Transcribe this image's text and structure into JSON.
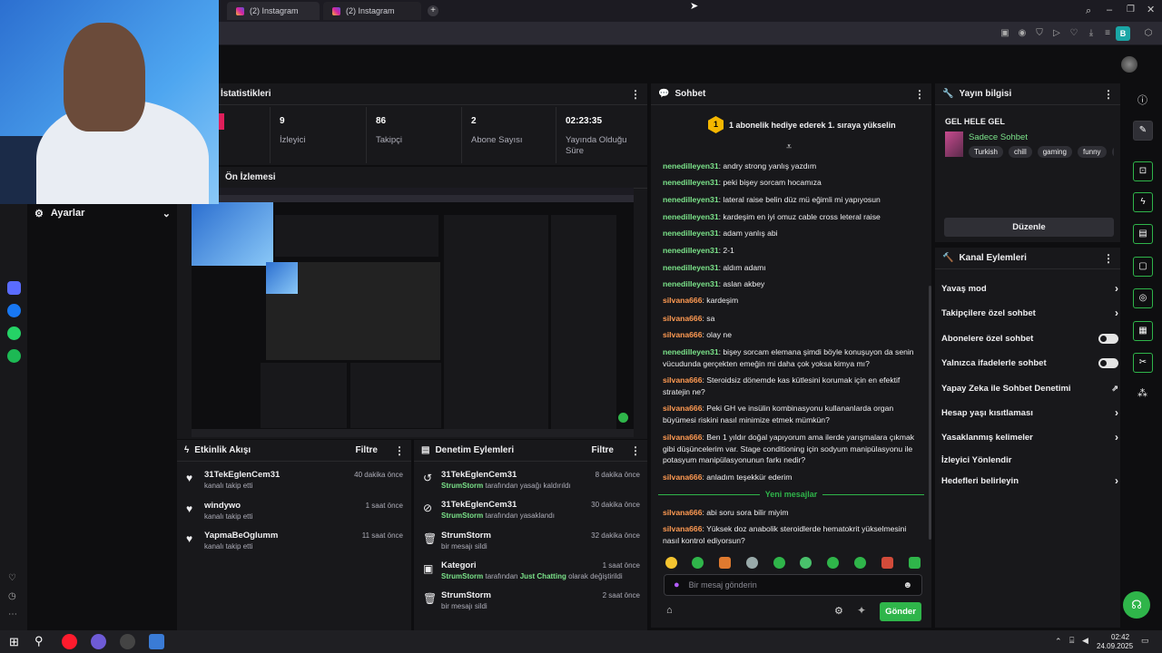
{
  "browser": {
    "tabs": [
      "(2) Instagram",
      "(2) Instagram"
    ],
    "profile_letter": "B"
  },
  "colors": {
    "accent": "#2fb54a",
    "chat_green": "#7be38a",
    "chat_orange": "#ff9a52",
    "panel": "#18181b",
    "bg": "#0e0e10"
  },
  "stats": {
    "title": "İstatistikleri",
    "items": [
      {
        "value": "9",
        "label": "İzleyici"
      },
      {
        "value": "86",
        "label": "Takipçi"
      },
      {
        "value": "2",
        "label": "Abone Sayısı"
      },
      {
        "value": "02:23:35",
        "label": "Yayında Olduğu Süre"
      }
    ]
  },
  "preview": {
    "title": "Ön İzlemesi"
  },
  "left_menu": {
    "ayarlar": "Ayarlar"
  },
  "activity": {
    "title": "Etkinlik Akışı",
    "filter": "Filtre",
    "items": [
      {
        "name": "31TekEglenCem31",
        "sub": "kanalı takip etti",
        "time": "40 dakika önce"
      },
      {
        "name": "windywo",
        "sub": "kanalı takip etti",
        "time": "1 saat önce"
      },
      {
        "name": "YapmaBeOglumm",
        "sub": "kanalı takip etti",
        "time": "11 saat önce"
      }
    ]
  },
  "moderation": {
    "title": "Denetim Eylemleri",
    "filter": "Filtre",
    "items": [
      {
        "name": "31TekEglenCem31",
        "actor": "StrumStorm",
        "sub": "tarafından yasağı kaldırıldı",
        "time": "8 dakika önce"
      },
      {
        "name": "31TekEglenCem31",
        "actor": "StrumStorm",
        "sub": "tarafından yasaklandı",
        "time": "30 dakika önce"
      },
      {
        "name": "StrumStorm",
        "actor": "",
        "sub": "bir mesajı sildi",
        "time": "32 dakika önce"
      },
      {
        "name": "Kategori",
        "actor": "StrumStorm",
        "sub": "tarafından",
        "sub_extra": "Just Chatting",
        "sub_end": "olarak değiştirildi",
        "time": "1 saat önce"
      },
      {
        "name": "StrumStorm",
        "actor": "",
        "sub": "bir mesajı sildi",
        "time": "2 saat önce"
      }
    ]
  },
  "chat": {
    "title": "Sohbet",
    "banner": "1 abonelik hediye ederek 1. sıraya yükselin",
    "banner_badge": "1",
    "messages": [
      {
        "user": "nenedilleyen31",
        "color": "green",
        "text": "andry strong yanlış yazdım"
      },
      {
        "user": "nenedilleyen31",
        "color": "green",
        "text": "peki bişey sorcam hocamıza"
      },
      {
        "user": "nenedilleyen31",
        "color": "green",
        "text": "lateral raise belin düz mü eğimli mi yapıyosun"
      },
      {
        "user": "nenedilleyen31",
        "color": "green",
        "text": "kardeşim en iyi omuz cable cross leteral raise"
      },
      {
        "user": "nenedilleyen31",
        "color": "green",
        "text": "adam yanlış abi"
      },
      {
        "user": "nenedilleyen31",
        "color": "green",
        "text": "2-1"
      },
      {
        "user": "nenedilleyen31",
        "color": "green",
        "text": "aldım adamı"
      },
      {
        "user": "nenedilleyen31",
        "color": "green",
        "text": "aslan akbey"
      },
      {
        "user": "silvana666",
        "color": "orange",
        "text": "kardeşim"
      },
      {
        "user": "silvana666",
        "color": "orange",
        "text": "sa"
      },
      {
        "user": "silvana666",
        "color": "orange",
        "text": "olay ne"
      },
      {
        "user": "nenedilleyen31",
        "color": "green",
        "text": "bişey sorcam elemana şimdi böyle konuşuyon da senin vücudunda gerçekten emeğin mi daha çok yoksa kimya mı?"
      },
      {
        "user": "silvana666",
        "color": "orange",
        "text": "Steroidsiz dönemde kas kütlesini korumak için en efektif stratejin ne?"
      },
      {
        "user": "silvana666",
        "color": "orange",
        "text": "Peki GH ve insülin kombinasyonu kullananlarda organ büyümesi riskini nasıl minimize etmek mümkün?"
      },
      {
        "user": "silvana666",
        "color": "orange",
        "text": "Ben 1 yıldır doğal yapıyorum ama ilerde yarışmalara çıkmak gibi düşüncelerim var. Stage conditioning için sodyum manipülasyonu ile potasyum manipülasyonunun farkı nedir?"
      },
      {
        "user": "silvana666",
        "color": "orange",
        "text": "anladım teşekkür ederim"
      }
    ],
    "new_messages": "Yeni mesajlar",
    "new": [
      {
        "user": "silvana666",
        "color": "orange",
        "text": "abi soru sora bilir miyim"
      },
      {
        "user": "silvana666",
        "color": "orange",
        "text": "Yüksek doz anabolik steroidlerde hematokrit yükselmesini nasıl kontrol ediyorsun?"
      }
    ],
    "input_placeholder": "Bir mesaj gönderin",
    "send": "Gönder"
  },
  "stream_info": {
    "title": "Yayın bilgisi",
    "stream_title": "GEL HELE GEL",
    "category": "Sadece Sohbet",
    "tags": [
      "Turkish",
      "chill",
      "gaming",
      "funny",
      "de"
    ],
    "edit": "Düzenle"
  },
  "channel_actions": {
    "title": "Kanal Eylemleri",
    "items": [
      {
        "label": "Yavaş mod",
        "control": "chevron"
      },
      {
        "label": "Takipçilere özel sohbet",
        "control": "chevron"
      },
      {
        "label": "Abonelere özel sohbet",
        "control": "toggle"
      },
      {
        "label": "Yalnızca ifadelerle sohbet",
        "control": "toggle"
      },
      {
        "label": "Yapay Zeka ile Sohbet Denetimi",
        "control": "external"
      },
      {
        "label": "Hesap yaşı kısıtlaması",
        "control": "chevron"
      },
      {
        "label": "Yasaklanmış kelimeler",
        "control": "chevron"
      },
      {
        "label": "İzleyici Yönlendir",
        "control": "none"
      },
      {
        "label": "Hedefleri belirleyin",
        "control": "chevron"
      }
    ]
  },
  "taskbar": {
    "time": "02:42",
    "date": "24.09.2025"
  }
}
